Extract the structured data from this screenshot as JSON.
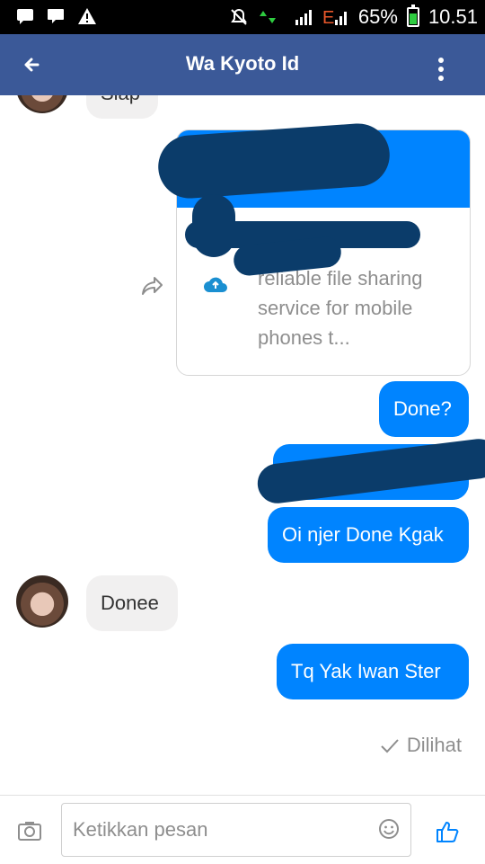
{
  "status_bar": {
    "battery_pct": "65%",
    "time": "10.51"
  },
  "header": {
    "title": "Wa Kyoto Id"
  },
  "messages": {
    "partial_top": "Siap",
    "card_text": "reliable file sharing service for mobile phones t...",
    "out1": "Done?",
    "out2": "Oi njer Done Kgak",
    "in1": "Donee",
    "out3": "Tq Yak Iwan Ster",
    "seen_label": "Dilihat"
  },
  "composer": {
    "placeholder": "Ketikkan pesan"
  },
  "colors": {
    "header": "#3b5998",
    "outgoing": "#0084ff",
    "incoming": "#f1f0f0",
    "scribble": "#0b3c6a"
  },
  "icons": [
    "back-arrow-icon",
    "more-vert-icon",
    "share-icon",
    "cloud-upload-icon",
    "check-icon",
    "camera-icon",
    "emoji-icon",
    "like-icon"
  ]
}
